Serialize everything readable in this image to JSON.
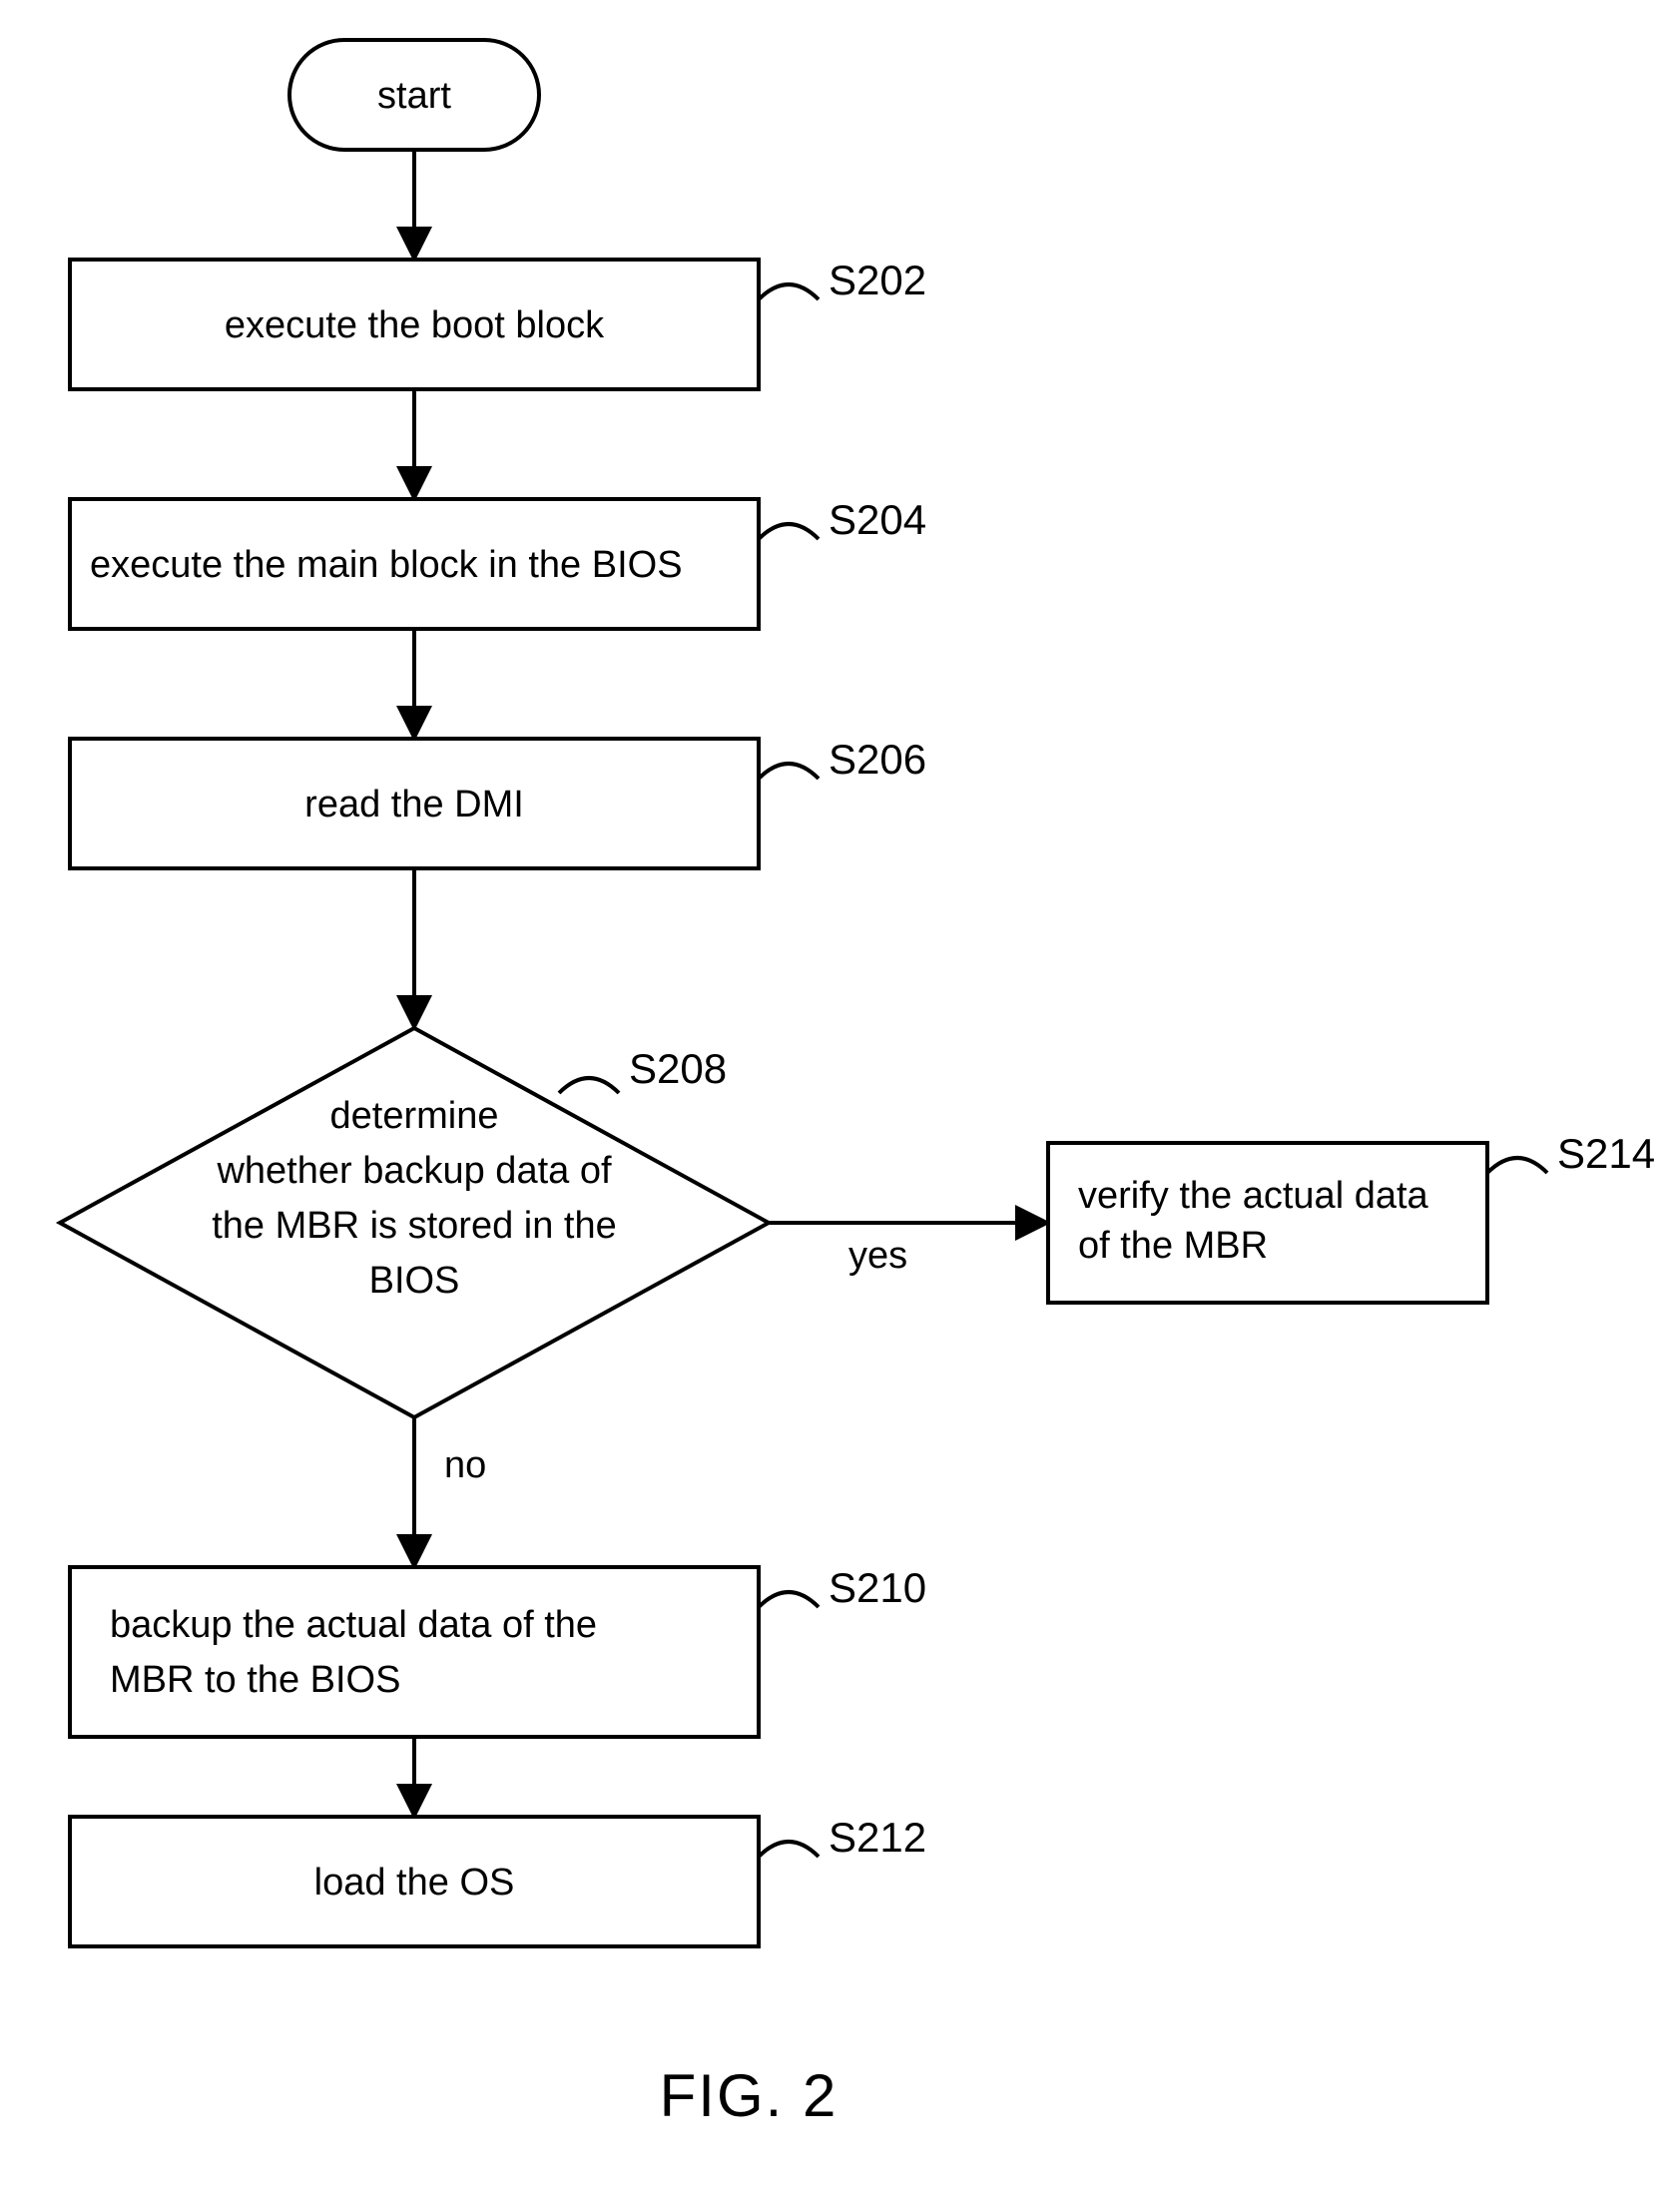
{
  "chart_data": {
    "type": "flowchart",
    "nodes": [
      {
        "id": "start",
        "kind": "terminator",
        "text": "start"
      },
      {
        "id": "s202",
        "kind": "process",
        "text": "execute the boot block",
        "label": "S202"
      },
      {
        "id": "s204",
        "kind": "process",
        "text": "execute the main block in the BIOS",
        "label": "S204"
      },
      {
        "id": "s206",
        "kind": "process",
        "text": "read the DMI",
        "label": "S206"
      },
      {
        "id": "s208",
        "kind": "decision",
        "text": "determine whether backup data of the MBR is stored in the BIOS",
        "label": "S208"
      },
      {
        "id": "s210",
        "kind": "process",
        "text": "backup the actual data of the MBR to the BIOS",
        "label": "S210"
      },
      {
        "id": "s212",
        "kind": "process",
        "text": "load the OS",
        "label": "S212"
      },
      {
        "id": "s214",
        "kind": "process",
        "text": "verify the actual data of the MBR",
        "label": "S214"
      }
    ],
    "edges": [
      {
        "from": "start",
        "to": "s202"
      },
      {
        "from": "s202",
        "to": "s204"
      },
      {
        "from": "s204",
        "to": "s206"
      },
      {
        "from": "s206",
        "to": "s208"
      },
      {
        "from": "s208",
        "to": "s210",
        "label": "no"
      },
      {
        "from": "s208",
        "to": "s214",
        "label": "yes"
      },
      {
        "from": "s210",
        "to": "s212"
      }
    ]
  },
  "start": {
    "text": "start"
  },
  "s202": {
    "text": "execute the boot block",
    "label": "S202"
  },
  "s204": {
    "text": "execute the main block in the BIOS",
    "label": "S204"
  },
  "s206": {
    "text": "read the DMI",
    "label": "S206"
  },
  "s208": {
    "line1": "determine",
    "line2": "whether backup data of",
    "line3": "the MBR is stored in the",
    "line4": "BIOS",
    "label": "S208",
    "yes": "yes",
    "no": "no"
  },
  "s210": {
    "line1": "backup the actual data of the",
    "line2": "MBR to the BIOS",
    "label": "S210"
  },
  "s212": {
    "text": "load the OS",
    "label": "S212"
  },
  "s214": {
    "line1": "verify the actual data",
    "line2": "of the MBR",
    "label": "S214"
  },
  "caption": "FIG. 2"
}
